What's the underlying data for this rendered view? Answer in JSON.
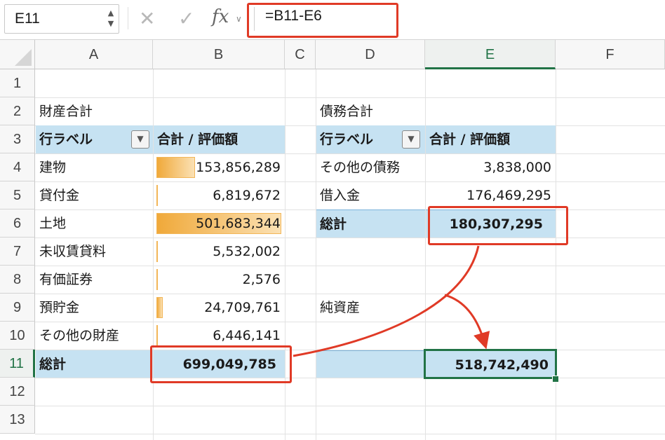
{
  "formula_bar": {
    "name_box": "E11",
    "cancel_icon": "cancel-x-icon",
    "enter_icon": "enter-check-icon",
    "fx_label": "fx",
    "formula": "=B11-E6"
  },
  "columns": [
    "A",
    "B",
    "C",
    "D",
    "E",
    "F"
  ],
  "rows": [
    "1",
    "2",
    "3",
    "4",
    "5",
    "6",
    "7",
    "8",
    "9",
    "10",
    "11",
    "12",
    "13"
  ],
  "left_pivot": {
    "title": "財産合計",
    "header_label": "行ラベル",
    "header_value": "合計 / 評価額",
    "items": [
      {
        "label": "建物",
        "value": "153,856,289",
        "fraction": 0.307
      },
      {
        "label": "貸付金",
        "value": "6,819,672",
        "fraction": 0.014
      },
      {
        "label": "土地",
        "value": "501,683,344",
        "fraction": 1.0
      },
      {
        "label": "未収賃貸料",
        "value": "5,532,002",
        "fraction": 0.011
      },
      {
        "label": "有価証券",
        "value": "2,576",
        "fraction": 0.0
      },
      {
        "label": "預貯金",
        "value": "24,709,761",
        "fraction": 0.049
      },
      {
        "label": "その他の財産",
        "value": "6,446,141",
        "fraction": 0.013
      }
    ],
    "total_label": "総計",
    "total_value": "699,049,785"
  },
  "right_pivot": {
    "title": "債務合計",
    "header_label": "行ラベル",
    "header_value": "合計 / 評価額",
    "items": [
      {
        "label": "その他の債務",
        "value": "3,838,000"
      },
      {
        "label": "借入金",
        "value": "176,469,295"
      }
    ],
    "total_label": "総計",
    "total_value": "180,307,295"
  },
  "net_assets": {
    "label": "純資産",
    "value": "518,742,490"
  },
  "colors": {
    "highlight": "#e03a26",
    "excel_green": "#217346",
    "pivot_blue": "#c6e2f2",
    "databar": "#f0a93a"
  }
}
